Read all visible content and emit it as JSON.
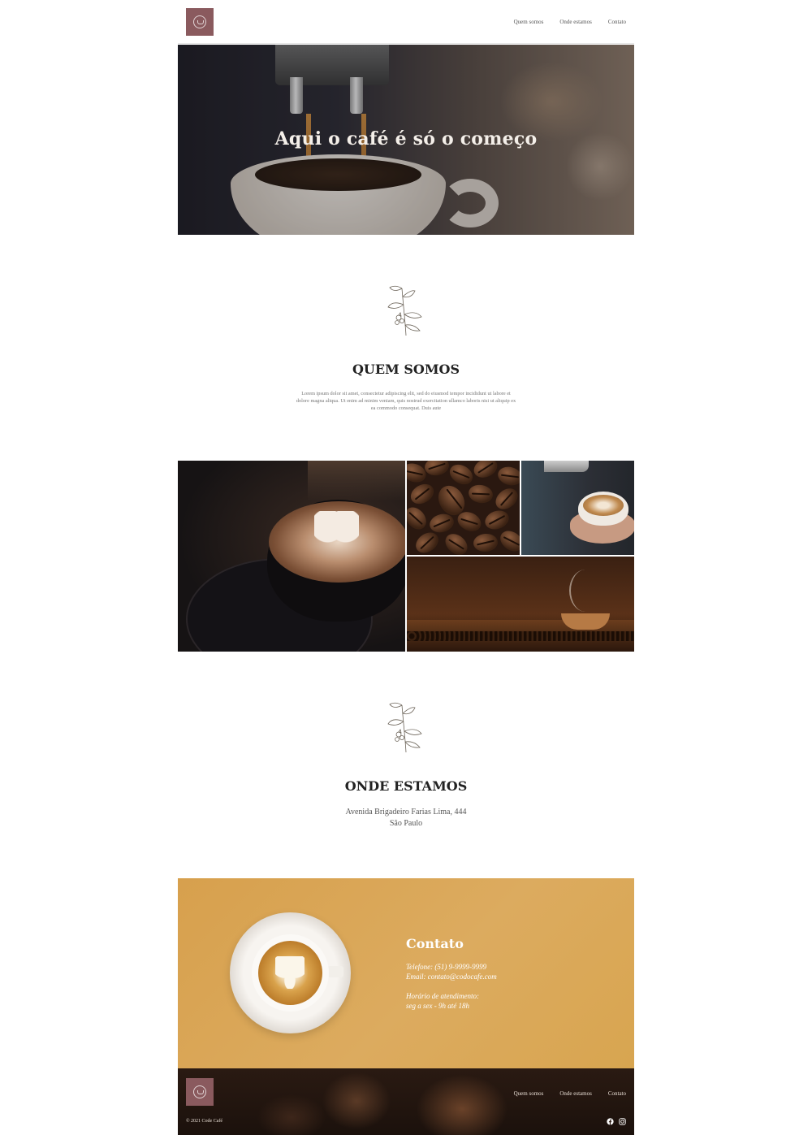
{
  "nav": {
    "items": [
      "Quem somos",
      "Onde estamos",
      "Contato"
    ]
  },
  "hero": {
    "title": "Aqui o café é só o começo"
  },
  "about": {
    "title": "QUEM SOMOS",
    "text": "Lorem ipsum dolor sit amet, consectetur adipiscing elit, sed do eiusmod tempor incididunt ut labore et dolore magna aliqua. Ut enim ad minim veniam, quis nostrud exercitation ullamco laboris nisi ut aliquip ex ea commodo consequat. Duis aute"
  },
  "location": {
    "title": "ONDE ESTAMOS",
    "address_line1": "Avenida Brigadeiro Farias Lima, 444",
    "address_line2": "São Paulo"
  },
  "contact": {
    "title": "Contato",
    "phone": "Telefone: (51) 9-9999-9999",
    "email": "Email: contato@codocafe.com",
    "hours_label": "Horário de atendimento:",
    "hours": "seg a sex - 9h até 18h"
  },
  "footer": {
    "nav": [
      "Quem somos",
      "Onde estamos",
      "Contato"
    ],
    "copyright": "© 2021 Code Café"
  },
  "icons": {
    "logo": "coffee-cup-logo",
    "branch": "coffee-branch-icon",
    "facebook": "facebook-icon",
    "instagram": "instagram-icon"
  },
  "colors": {
    "logo_bg": "#8a5a5e",
    "contact_bg": "#d8a550",
    "footer_bg": "#2a1a12"
  }
}
